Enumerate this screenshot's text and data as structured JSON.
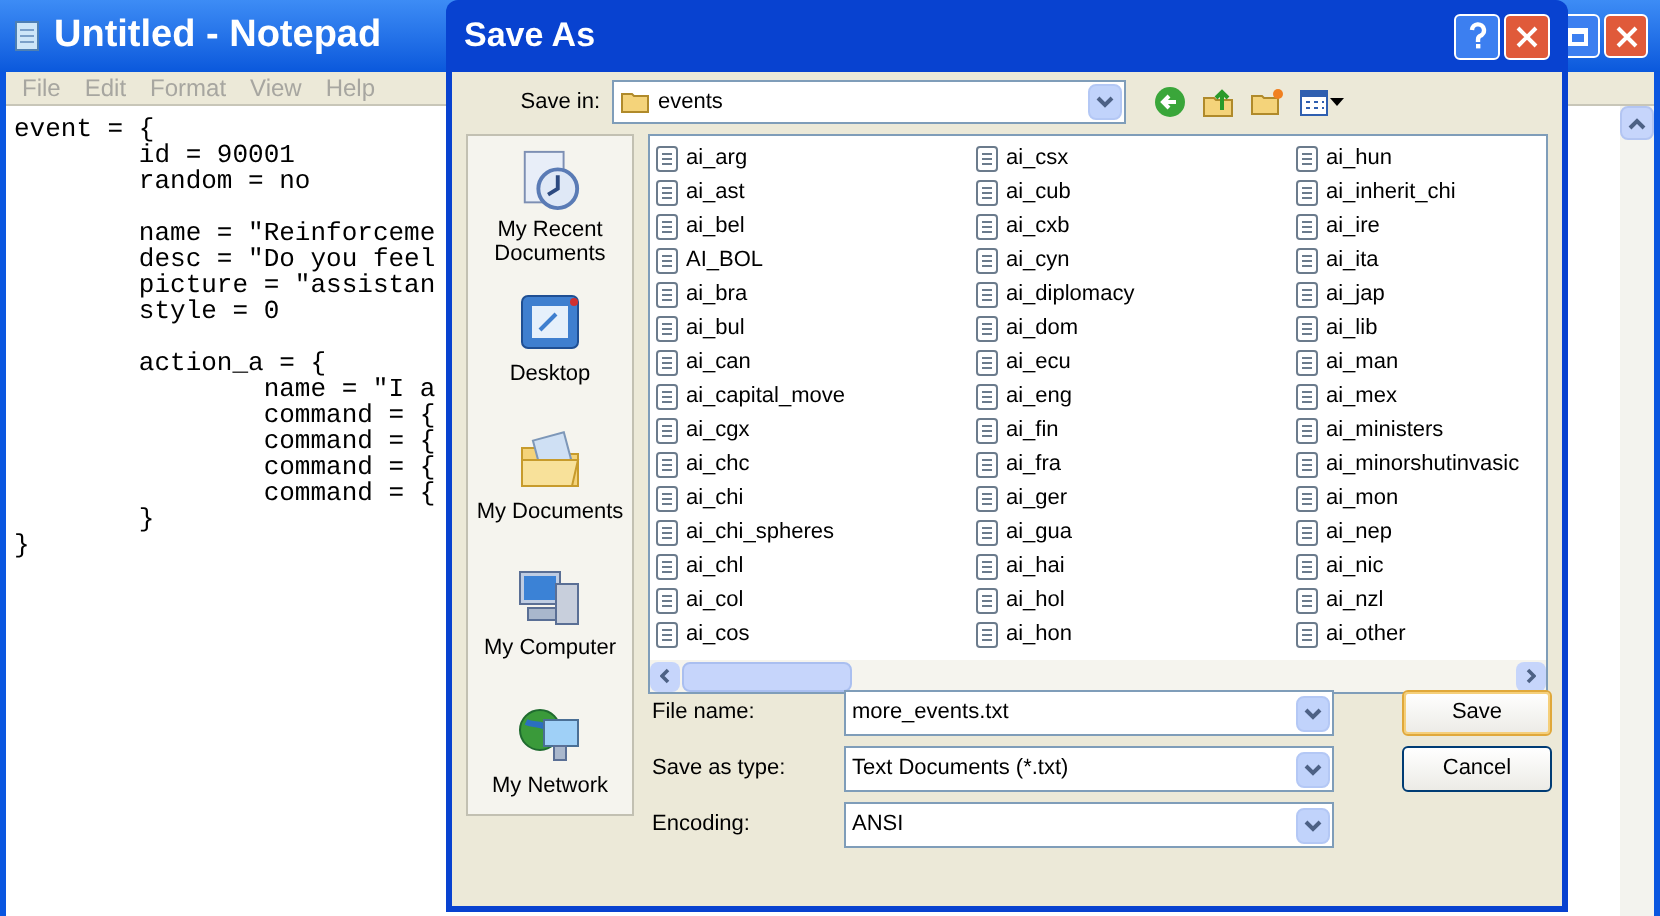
{
  "notepad": {
    "title": "Untitled - Notepad",
    "menu": [
      "File",
      "Edit",
      "Format",
      "View",
      "Help"
    ],
    "text": "event = {\n\tid = 90001\n\trandom = no\n\n\tname = \"Reinforceme\n\tdesc = \"Do you feel\n\tpicture = \"assistan\n\tstyle = 0\n\n\taction_a = {\n\t\tname = \"I a\n\t\tcommand = {\n\t\tcommand = {\n\t\tcommand = {\n\t\tcommand = {\n\t}\n}"
  },
  "dialog": {
    "title": "Save As",
    "save_in": {
      "label": "Save in:",
      "value": "events"
    },
    "places": [
      {
        "label": "My Recent Documents",
        "kind": "recent"
      },
      {
        "label": "Desktop",
        "kind": "desktop"
      },
      {
        "label": "My Documents",
        "kind": "documents"
      },
      {
        "label": "My Computer",
        "kind": "computer"
      },
      {
        "label": "My Network",
        "kind": "network"
      }
    ],
    "files": [
      "ai_arg",
      "ai_ast",
      "ai_bel",
      "AI_BOL",
      "ai_bra",
      "ai_bul",
      "ai_can",
      "ai_capital_move",
      "ai_cgx",
      "ai_chc",
      "ai_chi",
      "ai_chi_spheres",
      "ai_chl",
      "ai_col",
      "ai_cos",
      "ai_csx",
      "ai_cub",
      "ai_cxb",
      "ai_cyn",
      "ai_diplomacy",
      "ai_dom",
      "ai_ecu",
      "ai_eng",
      "ai_fin",
      "ai_fra",
      "ai_ger",
      "ai_gua",
      "ai_hai",
      "ai_hol",
      "ai_hon",
      "ai_hun",
      "ai_inherit_chi",
      "ai_ire",
      "ai_ita",
      "ai_jap",
      "ai_lib",
      "ai_man",
      "ai_mex",
      "ai_ministers",
      "ai_minorshutinvasic",
      "ai_mon",
      "ai_nep",
      "ai_nic",
      "ai_nzl",
      "ai_other"
    ],
    "fields": [
      {
        "label": "File name:",
        "value": "more_events.txt"
      },
      {
        "label": "Save as type:",
        "value": "Text Documents (*.txt)"
      },
      {
        "label": "Encoding:",
        "value": "ANSI"
      }
    ],
    "buttons": [
      {
        "label": "Save",
        "default": true
      },
      {
        "label": "Cancel",
        "default": false
      }
    ]
  }
}
